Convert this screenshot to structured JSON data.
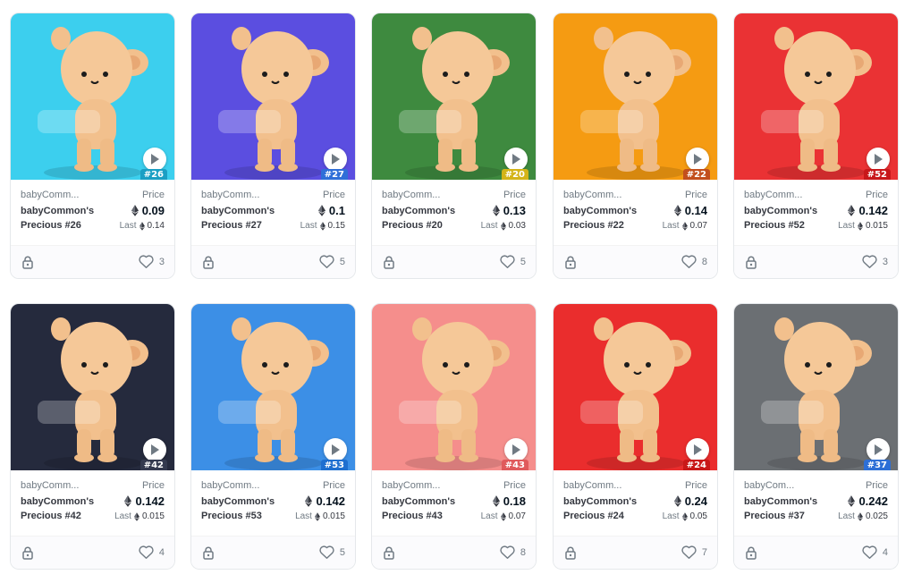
{
  "labels": {
    "price": "Price",
    "last": "Last"
  },
  "colors": {
    "ethereum": "#353840",
    "card_border": "#e5e8eb"
  },
  "cards": [
    {
      "collection": "babyComm...",
      "name": "babyCommon's Precious #26",
      "price": "0.09",
      "last": "0.14",
      "likes": "3",
      "tag": "#26",
      "bg": "#3ccfee",
      "tag_color": "#1b9fc4"
    },
    {
      "collection": "babyComm...",
      "name": "babyCommon's Precious #27",
      "price": "0.1",
      "last": "0.15",
      "likes": "5",
      "tag": "#27",
      "bg": "#5b4ee0",
      "tag_color": "#2f6fd8"
    },
    {
      "collection": "babyComm...",
      "name": "babyCommon's Precious #20",
      "price": "0.13",
      "last": "0.03",
      "likes": "5",
      "tag": "#20",
      "bg": "#3e8a3f",
      "tag_color": "#d4b417"
    },
    {
      "collection": "babyComm...",
      "name": "babyCommon's Precious #22",
      "price": "0.14",
      "last": "0.07",
      "likes": "8",
      "tag": "#22",
      "bg": "#f59b12",
      "tag_color": "#c24f1d"
    },
    {
      "collection": "babyComm...",
      "name": "babyCommon's Precious #52",
      "price": "0.142",
      "last": "0.015",
      "likes": "3",
      "tag": "#52",
      "bg": "#ea3234",
      "tag_color": "#c8171a"
    },
    {
      "collection": "babyComm...",
      "name": "babyCommon's Precious #42",
      "price": "0.142",
      "last": "0.015",
      "likes": "4",
      "tag": "#42",
      "bg": "#252a3d",
      "tag_color": "#343a4f"
    },
    {
      "collection": "babyComm...",
      "name": "babyCommon's Precious #53",
      "price": "0.142",
      "last": "0.015",
      "likes": "5",
      "tag": "#53",
      "bg": "#3c8fe6",
      "tag_color": "#1f6fd0"
    },
    {
      "collection": "babyComm...",
      "name": "babyCommon's Precious #43",
      "price": "0.18",
      "last": "0.07",
      "likes": "8",
      "tag": "#43",
      "bg": "#f58e8c",
      "tag_color": "#e05a5c"
    },
    {
      "collection": "babyComm...",
      "name": "babyCommon's Precious #24",
      "price": "0.24",
      "last": "0.05",
      "likes": "7",
      "tag": "#24",
      "bg": "#ea2d2d",
      "tag_color": "#c91818"
    },
    {
      "collection": "babyCom...",
      "name": "babyCommon's Precious #37",
      "price": "0.242",
      "last": "0.025",
      "likes": "4",
      "tag": "#37",
      "bg": "#6b6f73",
      "tag_color": "#2d6fd6"
    }
  ]
}
